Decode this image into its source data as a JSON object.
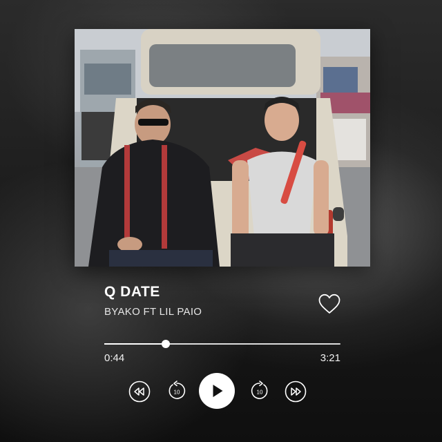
{
  "track": {
    "title": "Q DATE",
    "artist": "BYAKO FT LIL PAIO"
  },
  "playback": {
    "elapsed": "0:44",
    "total": "3:21",
    "progress_fraction": 0.26
  },
  "controls": {
    "skip_back_seconds": "10",
    "skip_forward_seconds": "10"
  },
  "icons": {
    "like": "heart-outline-icon",
    "rewind": "rewind-icon",
    "replay": "replay-10-icon",
    "play": "play-icon",
    "forward": "forward-10-icon",
    "fast_forward": "fast-forward-icon"
  },
  "colors": {
    "text": "#ffffff",
    "background": "#1c1c1c"
  }
}
